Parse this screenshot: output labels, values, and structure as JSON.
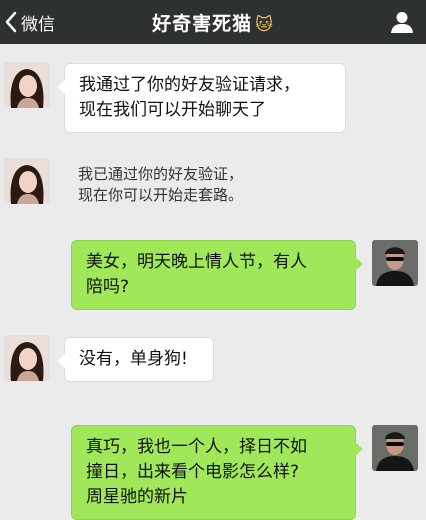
{
  "header": {
    "back_label": "微信",
    "title": "好奇害死猫",
    "title_emoji": "🐱",
    "profile_icon": "person-icon"
  },
  "colors": {
    "topbar": "#2e3132",
    "background": "#ebebeb",
    "sent_bubble": "#a0e75a",
    "received_bubble": "#ffffff"
  },
  "messages": [
    {
      "from": "friend",
      "lines": [
        "我通过了你的好友验证请求，",
        "现在我们可以开始聊天了"
      ]
    },
    {
      "from": "friend",
      "style": "plain",
      "lines": [
        "我已通过你的好友验证，",
        "现在你可以开始走套路。"
      ]
    },
    {
      "from": "me",
      "lines": [
        "美女，明天晚上情人节，有人",
        "陪吗?"
      ]
    },
    {
      "from": "friend",
      "lines": [
        "没有，单身狗!"
      ]
    },
    {
      "from": "me",
      "lines": [
        "真巧，我也一个人，择日不如",
        "撞日，出来看个电影怎么样?",
        "周星驰的新片"
      ]
    }
  ]
}
